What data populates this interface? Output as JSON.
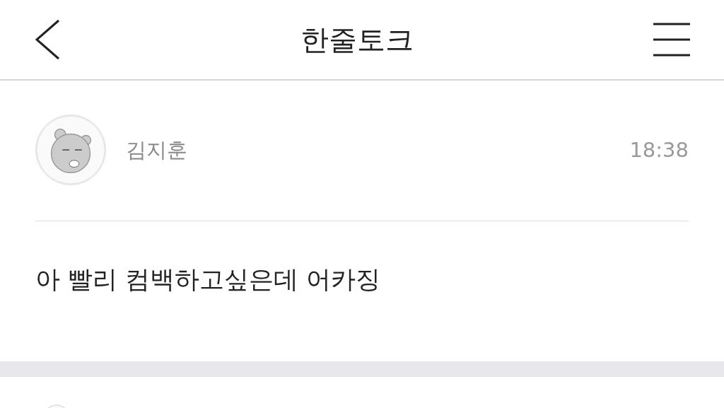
{
  "header": {
    "title": "한줄토크"
  },
  "post": {
    "author": "김지훈",
    "time": "18:38",
    "message": "아 빨리 컴백하고싶은데 어카징"
  }
}
